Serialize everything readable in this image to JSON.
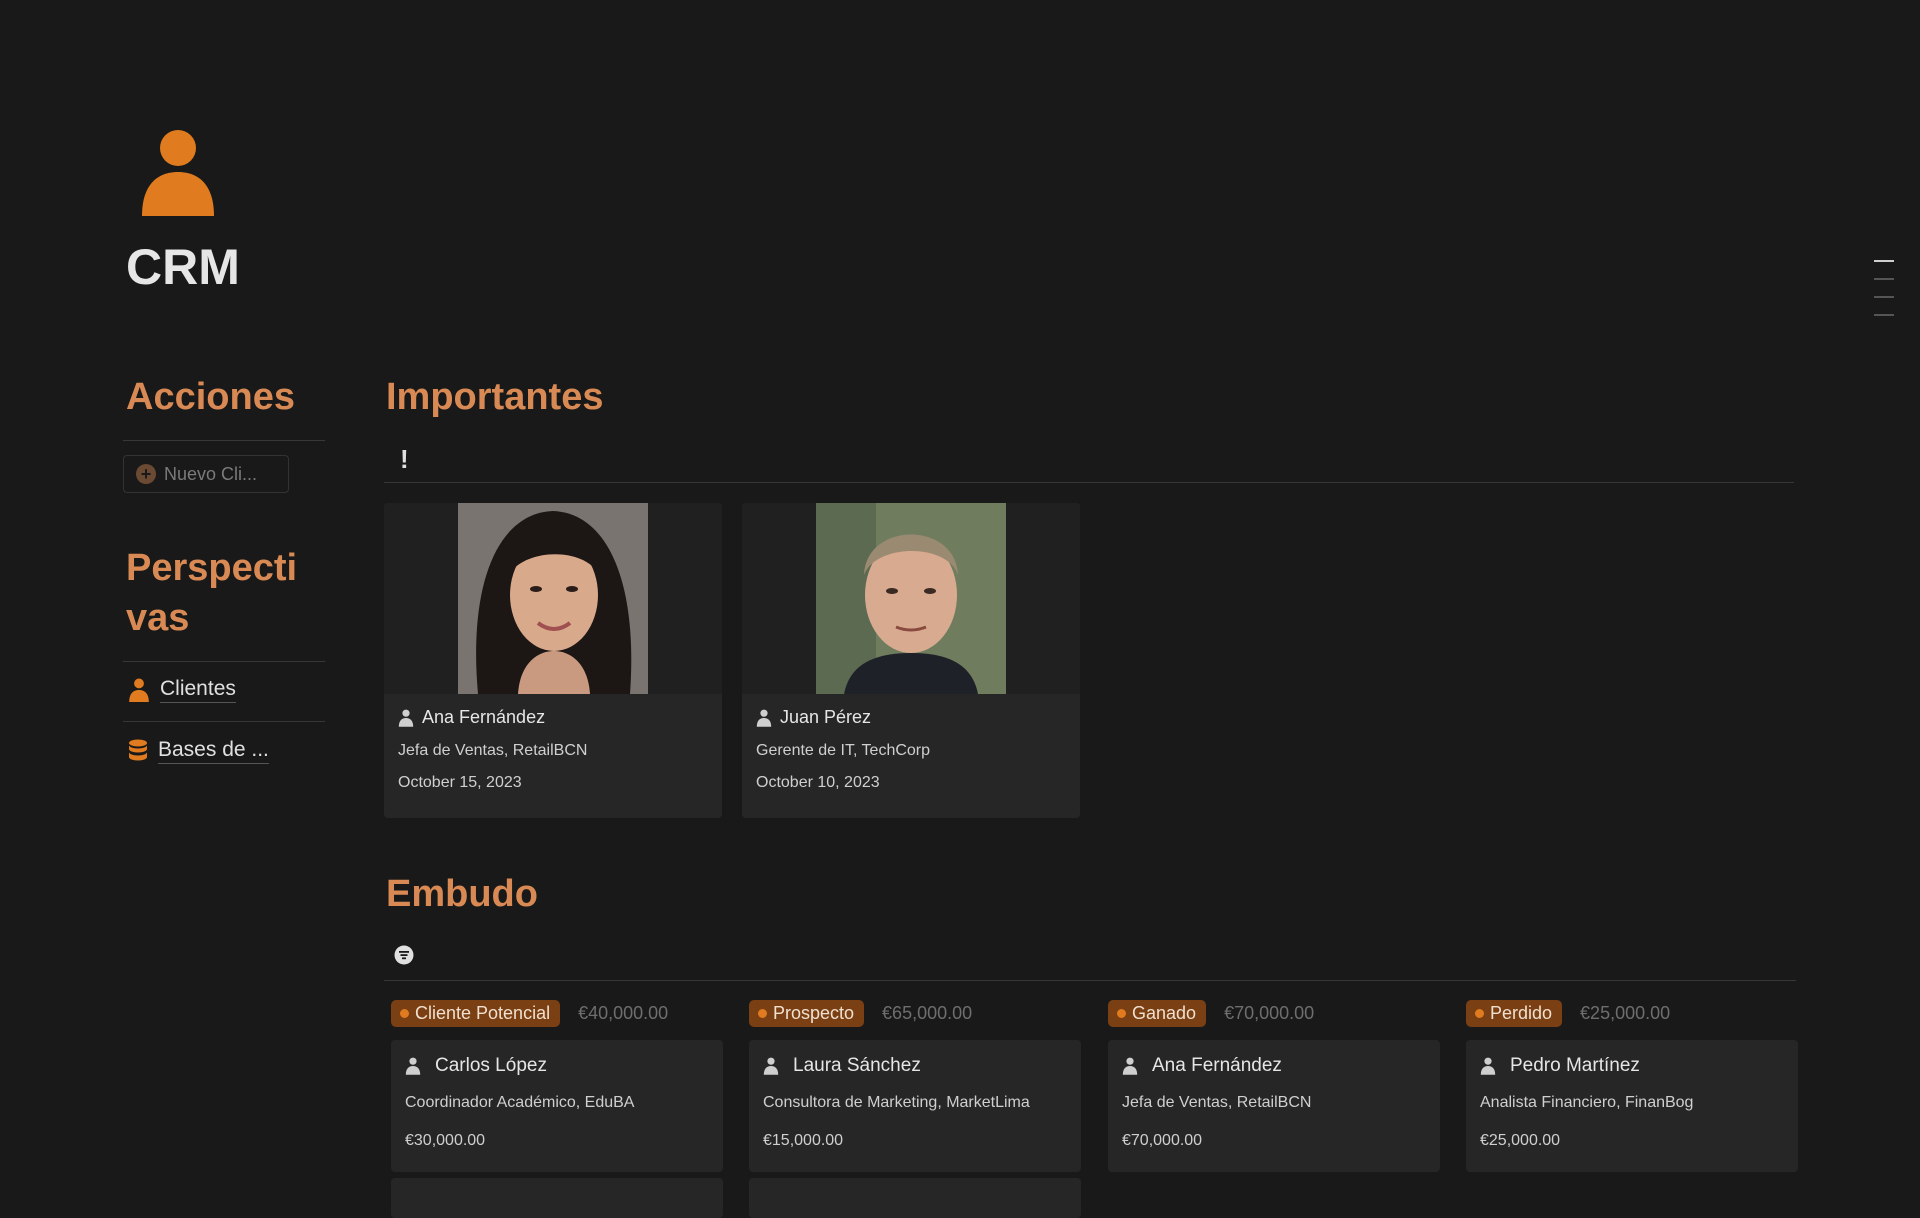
{
  "page": {
    "title": "CRM",
    "icon": "person-icon",
    "accent": "#d98a54"
  },
  "sidebar": {
    "actions_heading": "Acciones",
    "new_client_button": "Nuevo Cli...",
    "perspectives_heading_line1": "Perspecti",
    "perspectives_heading_line2": "vas",
    "links": [
      {
        "label": "Clientes",
        "icon": "person-icon"
      },
      {
        "label": "Bases de ...",
        "icon": "database-icon"
      }
    ]
  },
  "important": {
    "heading": "Importantes",
    "view_icon": "exclamation-icon",
    "cards": [
      {
        "name": "Ana Fernández",
        "role": "Jefa de Ventas, RetailBCN",
        "date": "October 15, 2023",
        "photo": "portrait-woman"
      },
      {
        "name": "Juan Pérez",
        "role": "Gerente de IT, TechCorp",
        "date": "October 10, 2023",
        "photo": "portrait-man"
      }
    ]
  },
  "funnel": {
    "heading": "Embudo",
    "view_icon": "filter-icon",
    "columns": [
      {
        "status": "Cliente Potencial",
        "sum": "€40,000.00",
        "card": {
          "name": "Carlos López",
          "role": "Coordinador Académico, EduBA",
          "value": "€30,000.00"
        }
      },
      {
        "status": "Prospecto",
        "sum": "€65,000.00",
        "card": {
          "name": "Laura Sánchez",
          "role": "Consultora de Marketing, MarketLima",
          "value": "€15,000.00"
        }
      },
      {
        "status": "Ganado",
        "sum": "€70,000.00",
        "card": {
          "name": "Ana Fernández",
          "role": "Jefa de Ventas, RetailBCN",
          "value": "€70,000.00"
        }
      },
      {
        "status": "Perdido",
        "sum": "€25,000.00",
        "card": {
          "name": "Pedro Martínez",
          "role": "Analista Financiero, FinanBog",
          "value": "€25,000.00"
        }
      }
    ]
  }
}
